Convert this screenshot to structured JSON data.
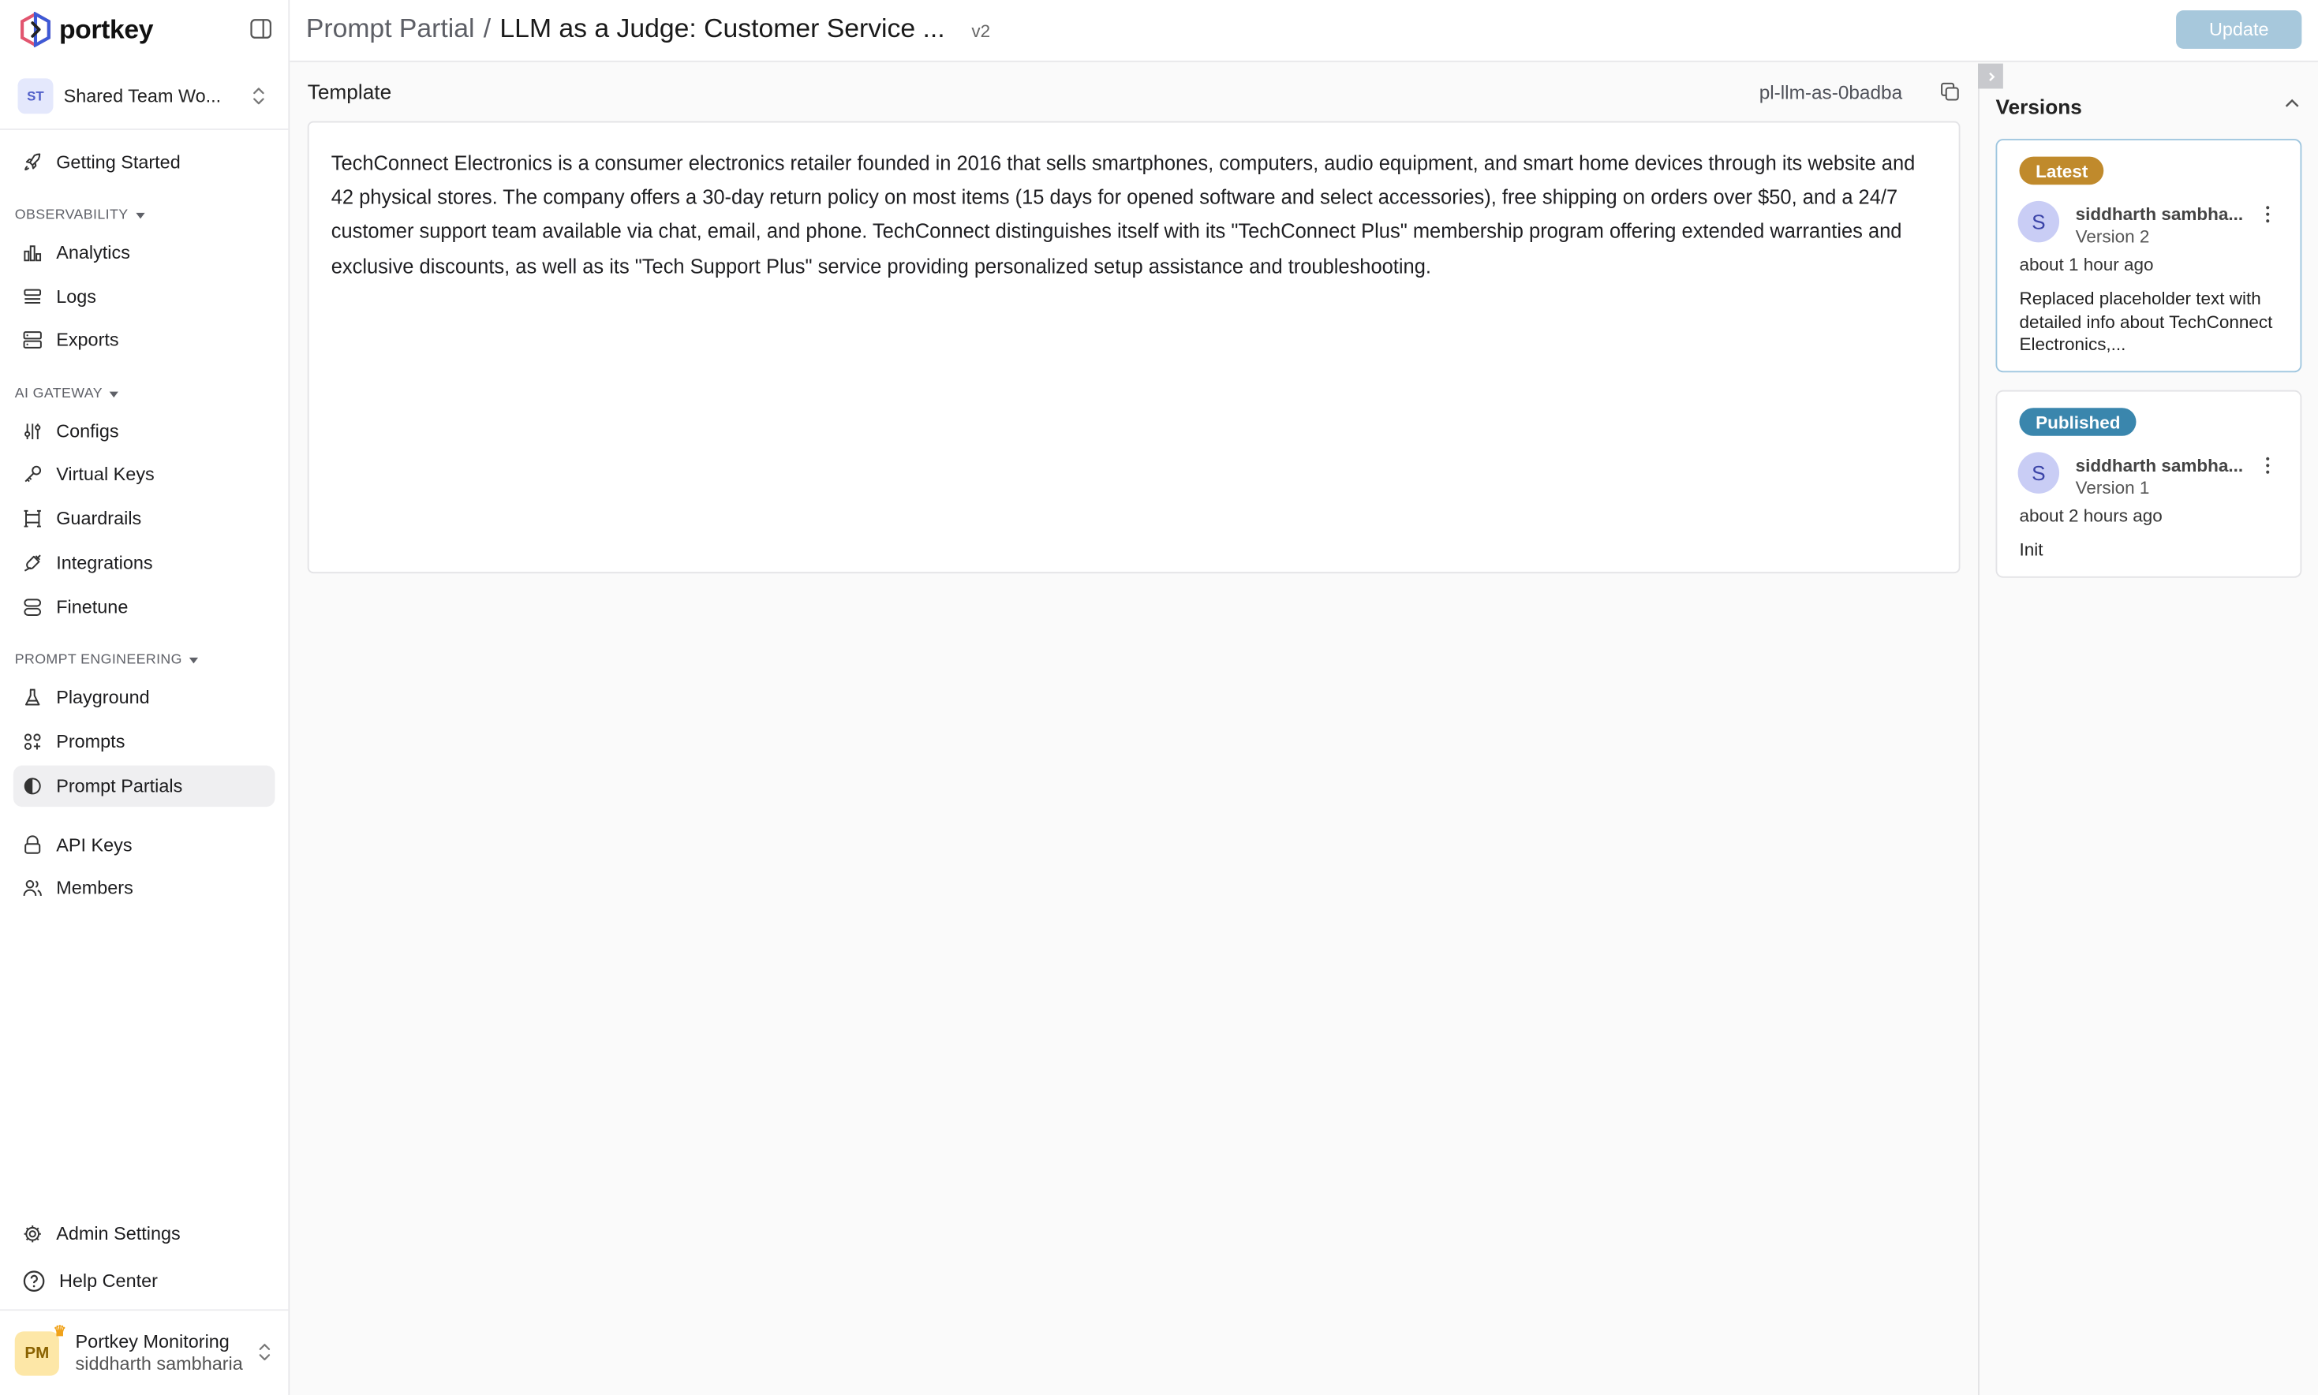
{
  "app": {
    "logo_text": "portkey"
  },
  "workspace": {
    "initials": "ST",
    "name": "Shared Team Wo..."
  },
  "sidebar": {
    "top_items": [
      {
        "label": "Getting Started",
        "icon": "rocket-icon"
      }
    ],
    "sections": [
      {
        "title": "OBSERVABILITY",
        "items": [
          {
            "label": "Analytics",
            "icon": "bar-chart-icon"
          },
          {
            "label": "Logs",
            "icon": "logs-icon"
          },
          {
            "label": "Exports",
            "icon": "server-icon"
          }
        ]
      },
      {
        "title": "AI GATEWAY",
        "items": [
          {
            "label": "Configs",
            "icon": "sliders-icon"
          },
          {
            "label": "Virtual Keys",
            "icon": "key-icon"
          },
          {
            "label": "Guardrails",
            "icon": "guardrails-icon"
          },
          {
            "label": "Integrations",
            "icon": "plug-icon"
          },
          {
            "label": "Finetune",
            "icon": "layers-icon"
          }
        ]
      },
      {
        "title": "PROMPT ENGINEERING",
        "items": [
          {
            "label": "Playground",
            "icon": "flask-icon"
          },
          {
            "label": "Prompts",
            "icon": "prompts-icon"
          },
          {
            "label": "Prompt Partials",
            "icon": "half-circle-icon",
            "active": true
          }
        ]
      }
    ],
    "extra_items": [
      {
        "label": "API Keys",
        "icon": "api-key-icon"
      },
      {
        "label": "Members",
        "icon": "users-icon"
      }
    ],
    "bottom_items": [
      {
        "label": "Admin Settings",
        "icon": "gear-icon"
      },
      {
        "label": "Help Center",
        "icon": "help-circle-icon"
      }
    ],
    "user": {
      "initials": "PM",
      "org": "Portkey Monitoring",
      "name": "siddharth sambharia"
    }
  },
  "header": {
    "breadcrumb_root": "Prompt Partial",
    "separator": "/",
    "title": "LLM as a Judge: Customer Service ...",
    "version": "v2",
    "update_label": "Update"
  },
  "template": {
    "label": "Template",
    "partial_id": "pl-llm-as-0badba",
    "text": "TechConnect Electronics is a consumer electronics retailer founded in 2016 that sells smartphones, computers, audio equipment, and smart home devices through its website and 42 physical stores. The company offers a 30-day return policy on most items (15 days for opened software and select accessories), free shipping on orders over $50, and a 24/7 customer support team available via chat, email, and phone. TechConnect distinguishes itself with its \"TechConnect Plus\" membership program offering extended warranties and exclusive discounts, as well as its \"Tech Support Plus\" service providing personalized setup assistance and troubleshooting."
  },
  "versions": {
    "title": "Versions",
    "cards": [
      {
        "tag": "Latest",
        "tag_color": "#c08a2c",
        "avatar": "S",
        "author": "siddharth sambha...",
        "version": "Version 2",
        "time": "about 1 hour ago",
        "message": "Replaced placeholder text with detailed info about TechConnect Electronics,..."
      },
      {
        "tag": "Published",
        "tag_color": "#3a86ad",
        "avatar": "S",
        "author": "siddharth sambha...",
        "version": "Version 1",
        "time": "about 2 hours ago",
        "message": "Init"
      }
    ]
  }
}
